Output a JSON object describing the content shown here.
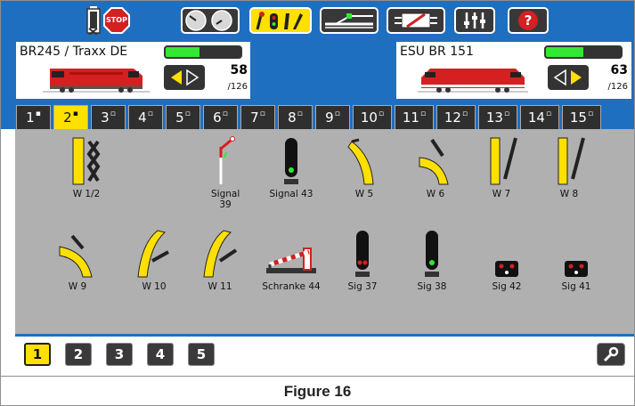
{
  "toolbar": {
    "stop_label": "STOP",
    "help_label": "?",
    "active_button": "keyboard"
  },
  "locos": [
    {
      "name": "BR245 / Traxx DE",
      "speed": "58",
      "max": "/126",
      "fill_fraction": 0.45,
      "direction": "forward"
    },
    {
      "name": "ESU BR 151",
      "speed": "63",
      "max": "/126",
      "fill_fraction": 0.5,
      "direction": "reverse"
    }
  ],
  "tabs": [
    "1",
    "2",
    "3",
    "4",
    "5",
    "6",
    "7",
    "8",
    "9",
    "10",
    "11",
    "12",
    "13",
    "14",
    "15"
  ],
  "active_tab": "2",
  "accessories": [
    {
      "label": "W 1/2",
      "icon": "double-turnout-icon"
    },
    {
      "label": "Signal 39",
      "icon": "semaphore-signal-icon"
    },
    {
      "label": "Signal 43",
      "icon": "light-signal-green-icon"
    },
    {
      "label": "W 5",
      "icon": "left-turnout-icon"
    },
    {
      "label": "W 6",
      "icon": "right-curve-turnout-icon"
    },
    {
      "label": "W 7",
      "icon": "straight-turnout-right-icon"
    },
    {
      "label": "W 8",
      "icon": "straight-turnout-right-icon"
    },
    {
      "label": "W 9",
      "icon": "curve-turnout-icon"
    },
    {
      "label": "W 10",
      "icon": "curve-turnout-icon"
    },
    {
      "label": "W 11",
      "icon": "curve-turnout-icon"
    },
    {
      "label": "Schranke 44",
      "icon": "level-crossing-barrier-icon"
    },
    {
      "label": "Sig 37",
      "icon": "light-signal-red-icon"
    },
    {
      "label": "Sig 38",
      "icon": "light-signal-green-icon"
    },
    {
      "label": "Sig 42",
      "icon": "shunting-signal-icon"
    },
    {
      "label": "Sig 41",
      "icon": "shunting-signal-icon"
    }
  ],
  "pages": [
    "1",
    "2",
    "3",
    "4",
    "5"
  ],
  "active_page": "1",
  "caption": "Figure 16",
  "colors": {
    "accent_blue": "#1f6fc0",
    "active_yellow": "#ffe000",
    "panel_gray": "#b0b0b0",
    "green": "#33e833",
    "stop_red": "#d42020"
  }
}
